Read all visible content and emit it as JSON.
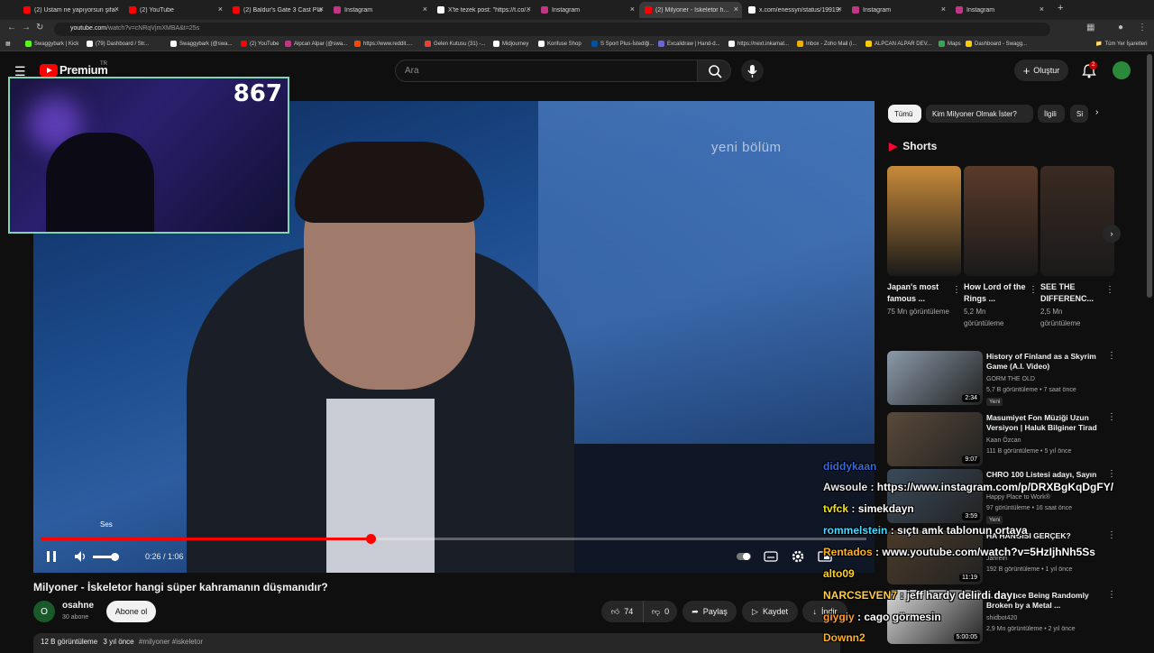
{
  "browser": {
    "tabs": [
      {
        "label": "(2) Ustam ne yapıyorsun şifa...",
        "color": "#ff0000",
        "active": false
      },
      {
        "label": "(2) YouTube",
        "color": "#ff0000",
        "active": false
      },
      {
        "label": "(2) Baldur's Gate 3 Cast Plays...",
        "color": "#ff0000",
        "active": false
      },
      {
        "label": "Instagram",
        "color": "#c13584",
        "active": false
      },
      {
        "label": "X'te tezek post: \"https://t.co/...",
        "color": "#ffffff",
        "active": false
      },
      {
        "label": "Instagram",
        "color": "#c13584",
        "active": false
      },
      {
        "label": "(2) Milyoner - İskeletor h...",
        "color": "#ff0000",
        "active": true
      },
      {
        "label": "x.com/enessyn/status/19919...",
        "color": "#ffffff",
        "active": false
      },
      {
        "label": "Instagram",
        "color": "#c13584",
        "active": false
      },
      {
        "label": "Instagram",
        "color": "#c13584",
        "active": false
      }
    ],
    "url_host": "youtube.com",
    "url_rest": "/watch?v=cNRqVjmXMBA&t=25s",
    "bookmarks": [
      {
        "label": "Swaggybark | Kick",
        "color": "#53fc18"
      },
      {
        "label": "(79) Dashboard / Str...",
        "color": "#ffffff"
      },
      {
        "label": "Swaggybark (@swa...",
        "color": "#ffffff"
      },
      {
        "label": "(2) YouTube",
        "color": "#ff0000"
      },
      {
        "label": "Alpcan Alpar (@swa...",
        "color": "#c13584"
      },
      {
        "label": "https://www.reddit....",
        "color": "#ff4500"
      },
      {
        "label": "Gelen Kutusu (31) -...",
        "color": "#ea4335"
      },
      {
        "label": "Midjourney",
        "color": "#ffffff"
      },
      {
        "label": "Konfuse Shop",
        "color": "#ffffff"
      },
      {
        "label": "S Sport Plus-İstediği...",
        "color": "#0050a0"
      },
      {
        "label": "Excalidraw | Hand-d...",
        "color": "#6965db"
      },
      {
        "label": "https://next.inkamat...",
        "color": "#ffffff"
      },
      {
        "label": "Inbox - Zoho Mail (i...",
        "color": "#f0b000"
      },
      {
        "label": "ALPCAN ALPAR DEV...",
        "color": "#ffcc00"
      },
      {
        "label": "Maps",
        "color": "#34a853"
      },
      {
        "label": "Dashboard - Swagg...",
        "color": "#ffcc00"
      }
    ],
    "all_bookmarks": "Tüm Yer İşaretleri"
  },
  "header": {
    "brand": "Premium",
    "country": "TR",
    "search_placeholder": "Ara",
    "create_label": "Oluştur",
    "notification_count": "2"
  },
  "stream_overlay": {
    "viewer_count": "867"
  },
  "video": {
    "watermark": "yeni bölüm",
    "tooltip": "Ses",
    "time": "0:26 / 1:06",
    "progress": 0.4,
    "volume": 0.85,
    "title": "Milyoner - İskeletor hangi süper kahramanın düşmanıdır?",
    "channel": "osahne",
    "channel_initial": "O",
    "subscribers": "30 abone",
    "subscribe_label": "Abone ol",
    "likes": "74",
    "dislikes": "0",
    "share_label": "Paylaş",
    "save_label": "Kaydet",
    "download_label": "İndir",
    "views": "12 B görüntüleme",
    "age": "3 yıl önce",
    "tags": "#milyoner #iskeletor"
  },
  "sidebar": {
    "chips": [
      "Tümü",
      "Kim Milyoner Olmak İster?",
      "İlgili",
      "Si"
    ],
    "shorts_title": "Shorts",
    "shorts": [
      {
        "title": "Japan's most famous ...",
        "views": "75 Mn görüntüleme",
        "color": "#c88a3a"
      },
      {
        "title": "How Lord of the Rings ...",
        "views": "5,2 Mn görüntüleme",
        "color": "#5a3a2a"
      },
      {
        "title": "SEE THE DIFFERENC...",
        "views": "2,5 Mn görüntüleme",
        "color": "#3a2a22"
      }
    ],
    "recommended": [
      {
        "title": "History of Finland as a Skyrim Game (A.I. Video)",
        "channel": "GORM THE OLD",
        "meta": "5,7 B görüntüleme • 7 saat önce",
        "badge": "Yeni",
        "duration": "2:34",
        "color": "#8a9aaa"
      },
      {
        "title": "Masumiyet Fon Müziği Uzun Versiyon | Haluk Bilginer Tirad",
        "channel": "Kaan Özcan",
        "meta": "111 B görüntüleme • 5 yıl önce",
        "badge": "",
        "duration": "9:07",
        "color": "#5a4a3a"
      },
      {
        "title": "CHRO 100 Listesi adayı, Sayın",
        "channel": "Happy Place to Work®",
        "meta": "97 görüntüleme • 16 saat önce",
        "badge": "Yeni",
        "duration": "3:59",
        "color": "#3a4a5a"
      },
      {
        "title": "HA HANGISI GERÇEK?",
        "channel": "Jahrein",
        "meta": "192 B görüntüleme • 1 yıl önce",
        "badge": "",
        "duration": "11:19",
        "color": "#4a3a2a"
      },
      {
        "title": "... Violence Being Randomly Broken by a Metal ...",
        "channel": "shidbot420",
        "meta": "2,9 Mn görüntüleme • 2 yıl önce",
        "badge": "",
        "duration": "5:00:05",
        "color": "#d8d8d8"
      }
    ]
  },
  "chat": [
    {
      "user": "diddykaan",
      "text": "",
      "color": "#3a6ad8"
    },
    {
      "user": "Awsoule",
      "text": "https://www.instagram.com/p/DRXBgKqDgFY/",
      "color": "#e8e8e8"
    },
    {
      "user": "tvfck",
      "text": "simekdayn",
      "color": "#f0e020"
    },
    {
      "user": "rommelstein",
      "text": "sıçtı amk tablonun ortaya",
      "color": "#4ad8ff"
    },
    {
      "user": "Rentados",
      "text": "www.youtube.com/watch?v=5HzIjhNh5Ss",
      "color": "#ffb020"
    },
    {
      "user": "alto09",
      "text": "",
      "color": "#ffd020"
    },
    {
      "user": "NARCSEVEN7",
      "text": "jeff hardy delirdi dayı",
      "color": "#ffcc40"
    },
    {
      "user": "giygiy",
      "text": "cago görmesin",
      "color": "#ff9a30"
    },
    {
      "user": "Downn2",
      "text": "",
      "color": "#ffb020"
    }
  ]
}
